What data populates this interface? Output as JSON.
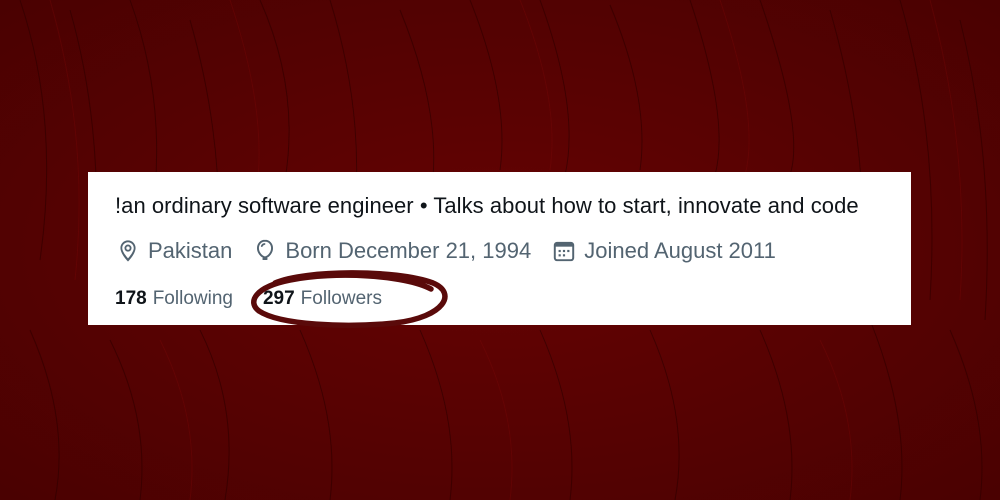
{
  "profile": {
    "bio": "!an ordinary software engineer • Talks about how to start, innovate and code",
    "location": {
      "icon": "location-pin-icon",
      "text": "Pakistan"
    },
    "birthday": {
      "icon": "balloon-icon",
      "text": "Born December 21, 1994"
    },
    "joined": {
      "icon": "calendar-icon",
      "text": "Joined August 2011"
    },
    "following": {
      "count": "178",
      "label": "Following"
    },
    "followers": {
      "count": "297",
      "label": "Followers"
    }
  },
  "colors": {
    "background": "#5a0202",
    "card": "#ffffff",
    "primary_text": "#0f1419",
    "secondary_text": "#536471",
    "highlight_ink": "#5a0a0a"
  }
}
